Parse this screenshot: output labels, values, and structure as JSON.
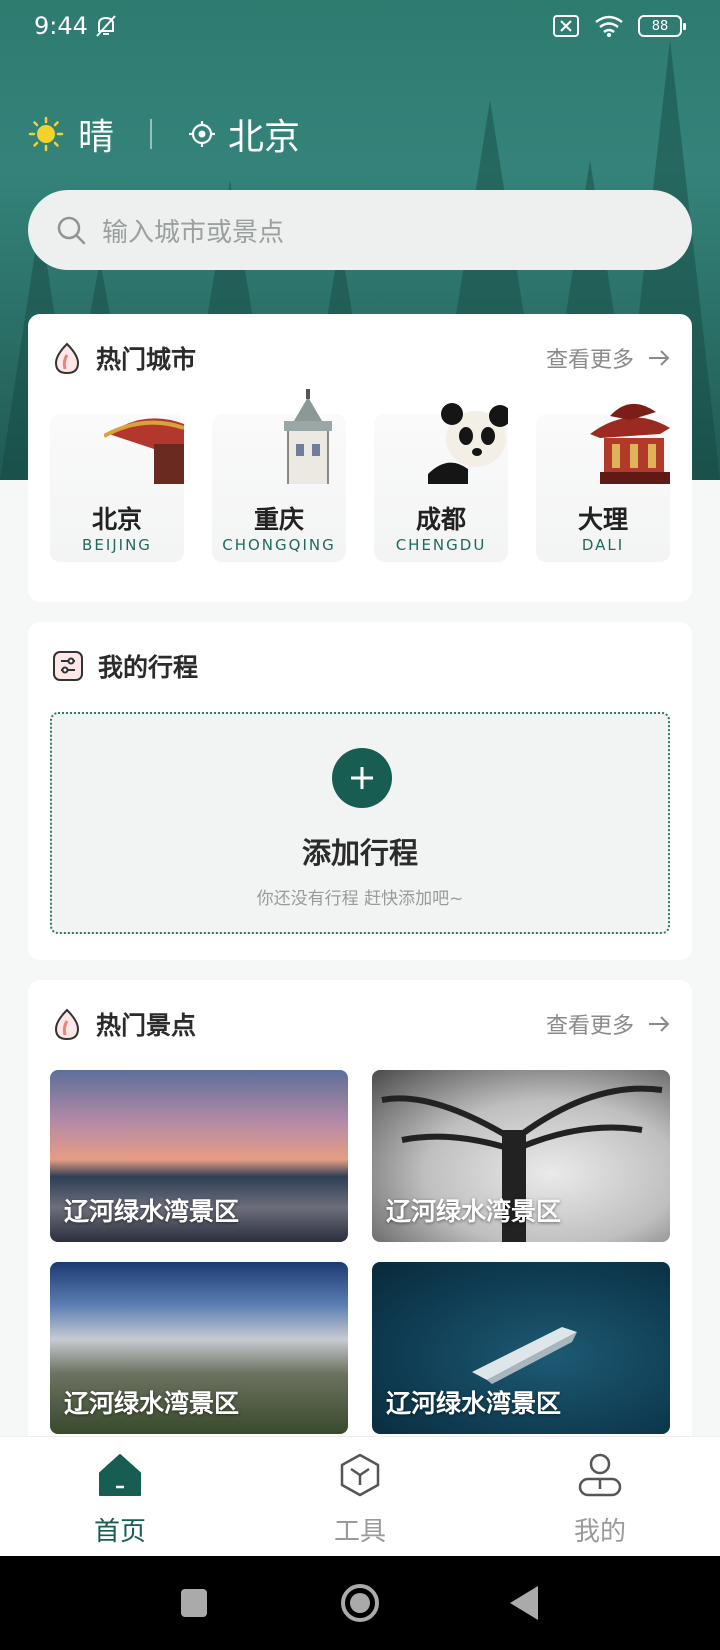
{
  "status": {
    "time": "9:44",
    "battery": "88"
  },
  "weather": {
    "condition": "晴",
    "city": "北京"
  },
  "search": {
    "placeholder": "输入城市或景点"
  },
  "hot_cities": {
    "title": "热门城市",
    "more": "查看更多",
    "items": [
      {
        "cn": "北京",
        "en": "BEIJING"
      },
      {
        "cn": "重庆",
        "en": "CHONGQING"
      },
      {
        "cn": "成都",
        "en": "CHENGDU"
      },
      {
        "cn": "大理",
        "en": "DALI"
      }
    ]
  },
  "my_trips": {
    "title": "我的行程",
    "add_title": "添加行程",
    "add_sub": "你还没有行程 赶快添加吧~"
  },
  "hot_spots": {
    "title": "热门景点",
    "more": "查看更多",
    "items": [
      {
        "name": "辽河绿水湾景区"
      },
      {
        "name": "辽河绿水湾景区"
      },
      {
        "name": "辽河绿水湾景区"
      },
      {
        "name": "辽河绿水湾景区"
      }
    ]
  },
  "nav": {
    "home": "首页",
    "tools": "工具",
    "mine": "我的"
  },
  "colors": {
    "accent": "#185d52",
    "hero": "#2e7b70"
  }
}
